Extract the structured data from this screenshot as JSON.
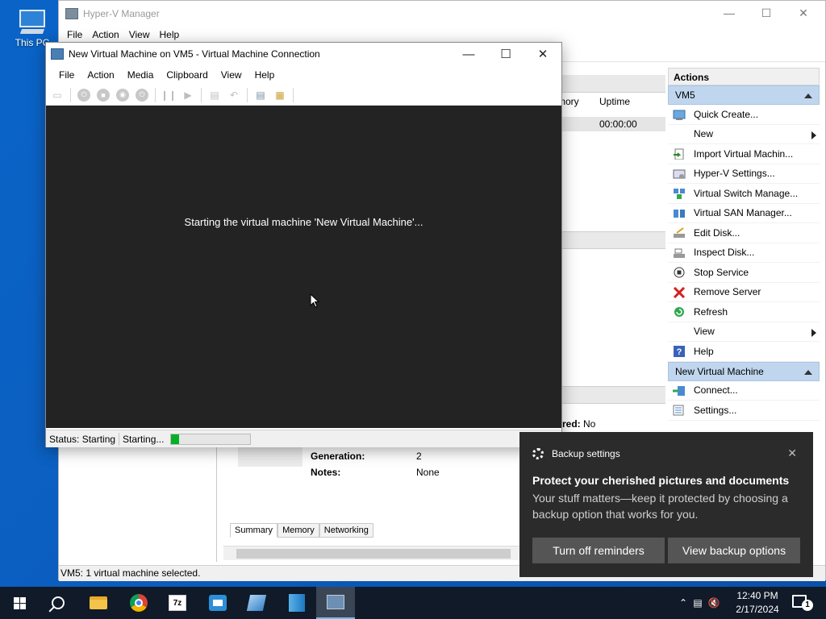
{
  "desktop": {
    "icon_label": "This PC"
  },
  "hyperv": {
    "title": "Hyper-V Manager",
    "menu": [
      "File",
      "Action",
      "View",
      "Help"
    ],
    "list_columns": {
      "memory": "mory",
      "uptime": "Uptime"
    },
    "row_uptime": "00:00:00",
    "details": {
      "replication_label": "red:",
      "replication_value": "No",
      "generation_label": "Generation:",
      "generation_value": "2",
      "notes_label": "Notes:",
      "notes_value": "None"
    },
    "tabs": [
      "Summary",
      "Memory",
      "Networking"
    ],
    "status": "VM5:  1 virtual machine selected."
  },
  "actions": {
    "title": "Actions",
    "section1": "VM5",
    "items1": [
      {
        "label": "Quick Create...",
        "icon": "quick-create-icon"
      },
      {
        "label": "New",
        "icon": "",
        "submenu": true
      },
      {
        "label": "Import Virtual Machin...",
        "icon": "import-icon"
      },
      {
        "label": "Hyper-V Settings...",
        "icon": "settings-icon"
      },
      {
        "label": "Virtual Switch Manage...",
        "icon": "switch-icon"
      },
      {
        "label": "Virtual SAN Manager...",
        "icon": "san-icon"
      },
      {
        "label": "Edit Disk...",
        "icon": "edit-disk-icon"
      },
      {
        "label": "Inspect Disk...",
        "icon": "inspect-disk-icon"
      },
      {
        "label": "Stop Service",
        "icon": "stop-icon"
      },
      {
        "label": "Remove Server",
        "icon": "remove-icon"
      },
      {
        "label": "Refresh",
        "icon": "refresh-icon"
      },
      {
        "label": "View",
        "icon": "",
        "submenu": true
      },
      {
        "label": "Help",
        "icon": "help-icon"
      }
    ],
    "section2": "New Virtual Machine",
    "items2": [
      {
        "label": "Connect...",
        "icon": "connect-icon"
      },
      {
        "label": "Settings...",
        "icon": "vm-settings-icon"
      }
    ]
  },
  "vmconnect": {
    "title": "New Virtual Machine on VM5 - Virtual Machine Connection",
    "menu": [
      "File",
      "Action",
      "Media",
      "Clipboard",
      "View",
      "Help"
    ],
    "screen_message": "Starting the virtual machine 'New Virtual Machine'...",
    "status_label": "Status: Starting",
    "progress_label": "Starting...",
    "progress": 0.1
  },
  "toast": {
    "app": "Backup settings",
    "title": "Protect your cherished pictures and documents",
    "body": "Your stuff matters—keep it protected by choosing a backup option that works for you.",
    "btn_off": "Turn off reminders",
    "btn_view": "View backup options"
  },
  "taskbar": {
    "time": "12:40 PM",
    "date": "2/17/2024",
    "zip_label": "7z",
    "notification_count": "1"
  },
  "colors": {
    "accent": "#0078d7",
    "progress": "#06b025",
    "toast_bg": "#2b2b2b",
    "section_bg": "#bfd6ee"
  }
}
